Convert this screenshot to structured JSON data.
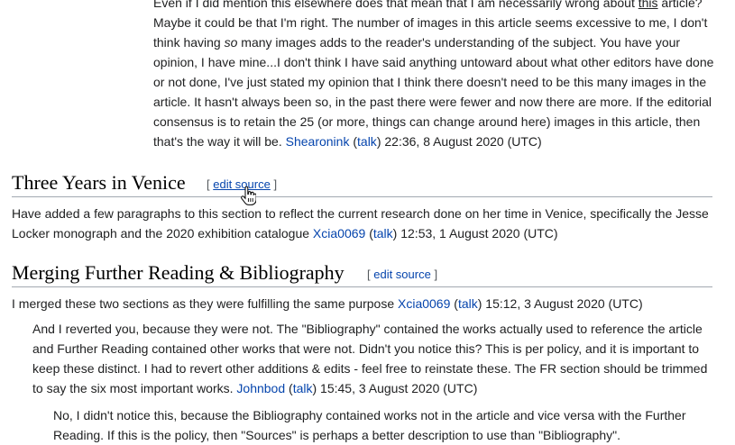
{
  "top_comment": {
    "before_this": "Even if I did mention this elsewhere does that mean that I am necessarily wrong about ",
    "this_word": "this",
    "before_so": " article? Maybe it could be that I'm right. The number of images in this article seems excessive to me, I don't think having ",
    "so_word": "so",
    "rest": " many images adds to the reader's understanding of the subject. You have your opinion, I have mine...I don't think I have said anything untoward about what other editors have done or not done, I've just stated my opinion that I think there doesn't need to be this many images in the article. It hasn't always been so, in the past there were fewer and now there are more. If the editorial consensus is to retain the 25 (or more, things can change around here) images in this article, then that's the way it will be. ",
    "user": "Shearonink",
    "talk": "talk",
    "timestamp": " 22:36, 8 August 2020 (UTC)"
  },
  "section_venice": {
    "title": "Three Years in Venice",
    "edit_open": "[ ",
    "edit_label": "edit source",
    "edit_close": " ]",
    "comment": {
      "text": "Have added a few paragraphs to this section to reflect the current research done on her time in Venice, specifically the Jesse Locker monograph and the 2020 exhibition catalogue ",
      "user": "Xcia0069",
      "talk": "talk",
      "timestamp": " 12:53, 1 August 2020 (UTC)"
    }
  },
  "section_merging": {
    "title": "Merging Further Reading & Bibliography",
    "edit_open": "[ ",
    "edit_label": "edit source",
    "edit_close": " ]",
    "comment1": {
      "text": "I merged these two sections as they were fulfilling the same purpose ",
      "user": "Xcia0069",
      "talk": "talk",
      "timestamp": " 15:12, 3 August 2020 (UTC)"
    },
    "comment2": {
      "text": "And I reverted you, because they were not. The \"Bibliography\" contained the works actually used to reference the article and Further Reading contained other works that were not. Didn't you notice this? This is per policy, and it is important to keep these distinct. I had to revert other additions & edits - feel free to reinstate these. The FR section should be trimmed to say the six most important works. ",
      "user": "Johnbod",
      "talk": "talk",
      "timestamp": " 15:45, 3 August 2020 (UTC)"
    },
    "comment3": {
      "text": "No, I didn't notice this, because the Bibliography contained works not in the article and vice versa with the Further Reading. If this is the policy, then \"Sources\" is perhaps a better description to use than \"Bibliography\"."
    }
  },
  "colors": {
    "link": "#0645ad",
    "text": "#202122",
    "heading_rule": "#a2a9b1"
  },
  "icons": {
    "cursor": "hand-pointer-icon"
  }
}
